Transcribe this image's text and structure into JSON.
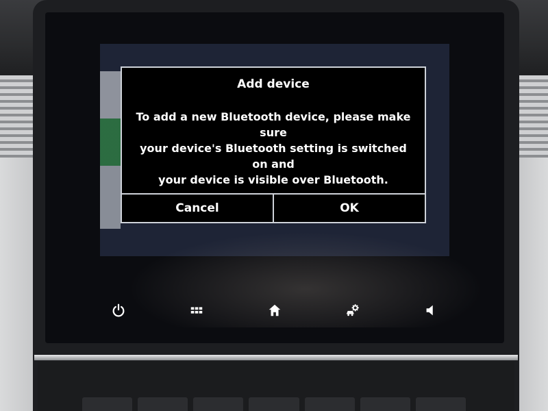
{
  "dialog": {
    "title": "Add device",
    "message_line1": "To add a new Bluetooth device, please make sure",
    "message_line2": "your device's Bluetooth setting is switched on and",
    "message_line3": "your device is visible over Bluetooth.",
    "cancel_label": "Cancel",
    "ok_label": "OK"
  },
  "bottom_bar": {
    "icons": [
      "power-icon",
      "apps-grid-icon",
      "home-icon",
      "car-settings-icon",
      "volume-icon"
    ]
  },
  "colors": {
    "dialog_background": "#000000",
    "dialog_border": "#cfd3da",
    "text": "#ffffff",
    "screen_background": "#0b0c10"
  }
}
